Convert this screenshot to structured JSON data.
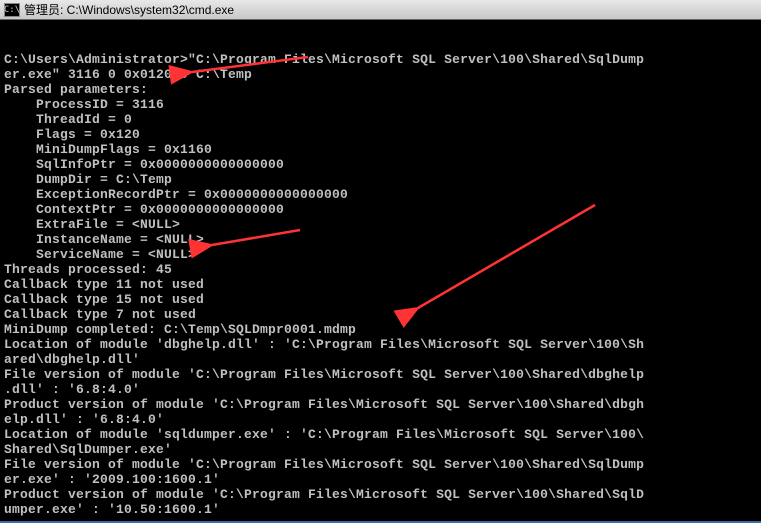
{
  "titlebar": {
    "icon_text": "C:\\",
    "title": "管理员: C:\\Windows\\system32\\cmd.exe"
  },
  "console_lines": [
    "",
    "C:\\Users\\Administrator>\"C:\\Program Files\\Microsoft SQL Server\\100\\Shared\\SqlDump",
    "er.exe\" 3116 0 0x0120 0 C:\\Temp",
    "Parsed parameters:",
    "    ProcessID = 3116",
    "    ThreadId = 0",
    "    Flags = 0x120",
    "    MiniDumpFlags = 0x1160",
    "    SqlInfoPtr = 0x0000000000000000",
    "    DumpDir = C:\\Temp",
    "    ExceptionRecordPtr = 0x0000000000000000",
    "    ContextPtr = 0x0000000000000000",
    "    ExtraFile = <NULL>",
    "    InstanceName = <NULL>",
    "    ServiceName = <NULL>",
    "Threads processed: 45",
    "Callback type 11 not used",
    "Callback type 15 not used",
    "Callback type 7 not used",
    "MiniDump completed: C:\\Temp\\SQLDmpr0001.mdmp",
    "Location of module 'dbghelp.dll' : 'C:\\Program Files\\Microsoft SQL Server\\100\\Sh",
    "ared\\dbghelp.dll'",
    "File version of module 'C:\\Program Files\\Microsoft SQL Server\\100\\Shared\\dbghelp",
    ".dll' : '6.8:4.0'",
    "Product version of module 'C:\\Program Files\\Microsoft SQL Server\\100\\Shared\\dbgh",
    "elp.dll' : '6.8:4.0'",
    "Location of module 'sqldumper.exe' : 'C:\\Program Files\\Microsoft SQL Server\\100\\",
    "Shared\\SqlDumper.exe'",
    "File version of module 'C:\\Program Files\\Microsoft SQL Server\\100\\Shared\\SqlDump",
    "er.exe' : '2009.100:1600.1'",
    "Product version of module 'C:\\Program Files\\Microsoft SQL Server\\100\\Shared\\SqlD",
    "umper.exe' : '10.50:1600.1'"
  ],
  "arrows": {
    "color": "#ff3333"
  }
}
